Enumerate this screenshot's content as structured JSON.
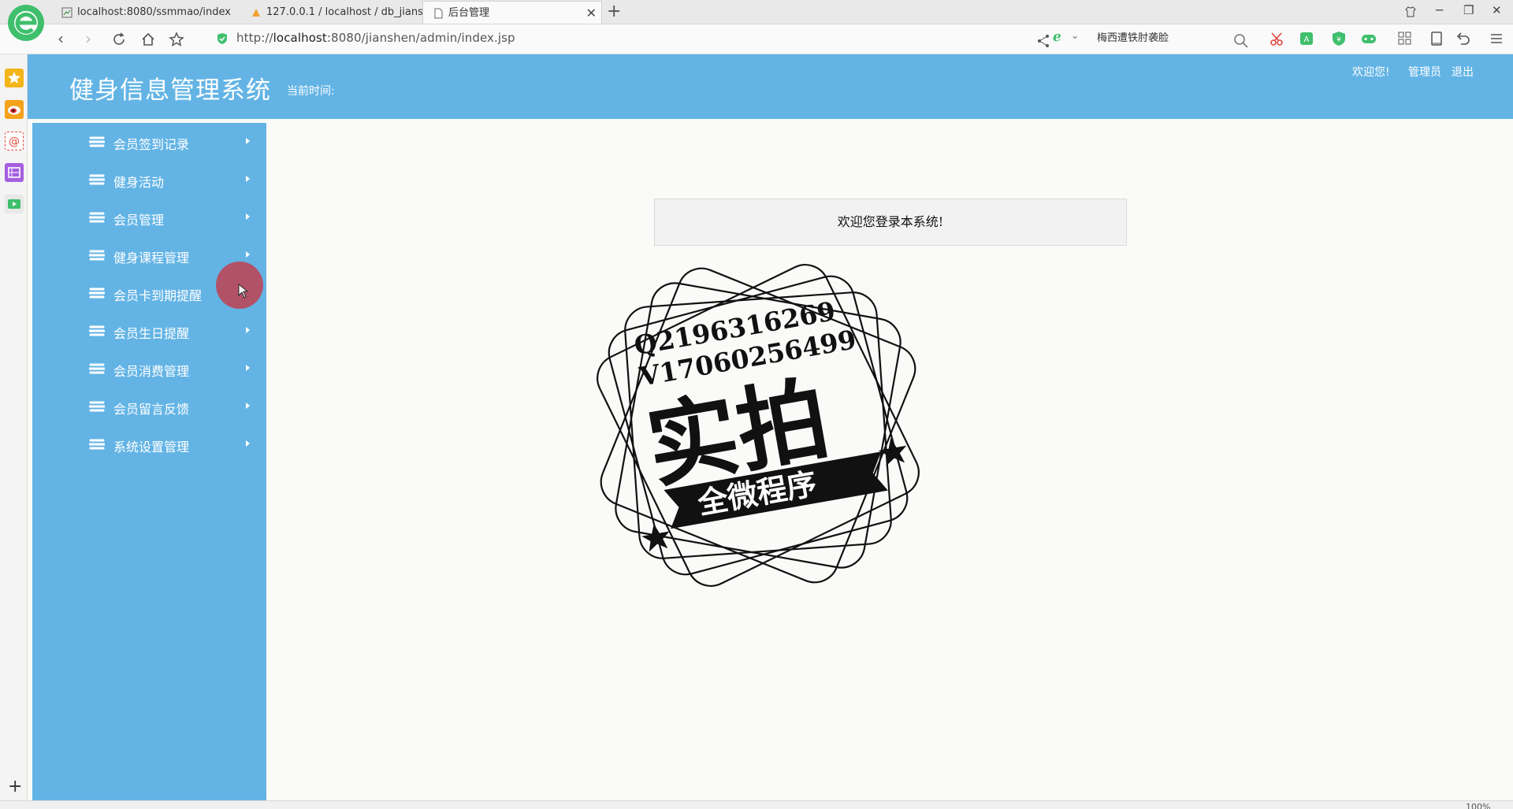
{
  "browser": {
    "tabs": [
      {
        "title": "localhost:8080/ssmmao/index",
        "active": false
      },
      {
        "title": "127.0.0.1 / localhost / db_jians",
        "active": false
      },
      {
        "title": "后台管理",
        "active": true
      }
    ],
    "url_prefix": "http://",
    "url_host": "localhost",
    "url_rest": ":8080/jianshen/admin/index.jsp",
    "search_text": "梅西遭铁肘袭脸",
    "brand_color": "#3fbf6c"
  },
  "header": {
    "title": "健身信息管理系统",
    "time_label": "当前时间:",
    "welcome": "欢迎您!",
    "user": "管理员",
    "logout": "退出",
    "color": "#63b4e5"
  },
  "sidebar": {
    "items": [
      {
        "label": "会员签到记录"
      },
      {
        "label": "健身活动"
      },
      {
        "label": "会员管理"
      },
      {
        "label": "健身课程管理"
      },
      {
        "label": "会员卡到期提醒"
      },
      {
        "label": "会员生日提醒"
      },
      {
        "label": "会员消费管理"
      },
      {
        "label": "会员留言反馈"
      },
      {
        "label": "系统设置管理"
      }
    ]
  },
  "main": {
    "welcome_message": "欢迎您登录本系统!"
  },
  "watermark": {
    "line1": "Q2196316269",
    "line2": "V17060256499",
    "big_text": "实拍",
    "ribbon_text": "全微程序"
  },
  "statusbar": {
    "zoom": "100%"
  }
}
